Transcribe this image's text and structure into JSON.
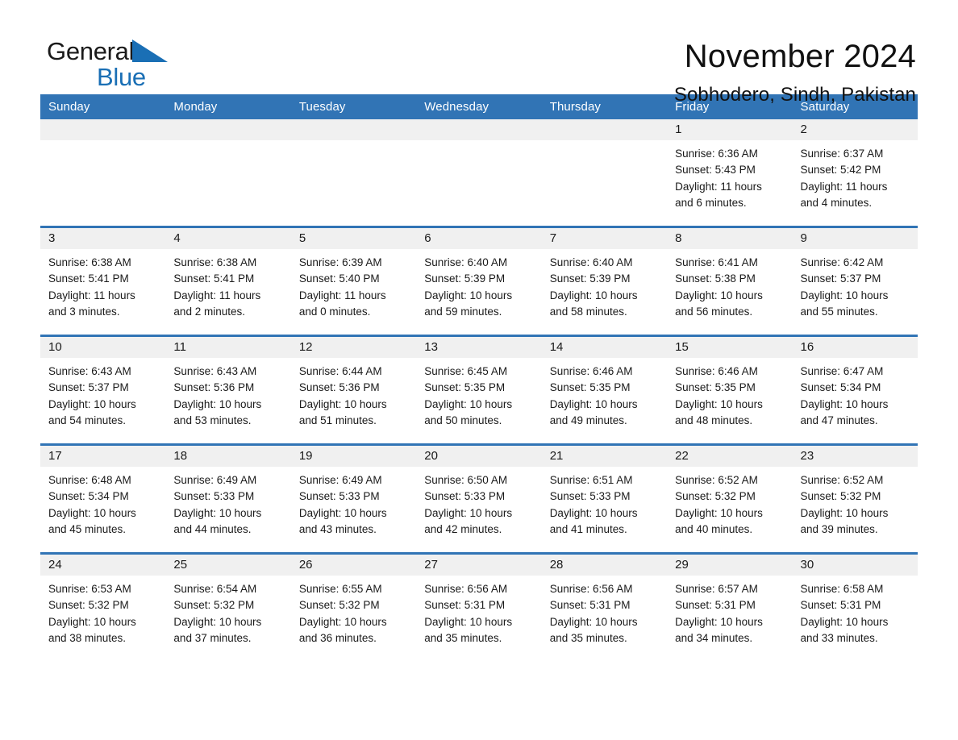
{
  "brand": {
    "name_part1": "General",
    "name_part2": "Blue",
    "logo_icon": "triangle-icon",
    "accent_color": "#1a6fb5"
  },
  "header": {
    "month_title": "November 2024",
    "location": "Sobhodero, Sindh, Pakistan"
  },
  "theme": {
    "header_blue": "#3174b5",
    "daynum_band": "#f0f0f0",
    "text": "#1a1a1a"
  },
  "weekday_headers": [
    "Sunday",
    "Monday",
    "Tuesday",
    "Wednesday",
    "Thursday",
    "Friday",
    "Saturday"
  ],
  "weeks": [
    [
      {
        "day": "",
        "empty": true,
        "sunrise": "",
        "sunset": "",
        "daylight_line1": "",
        "daylight_line2": ""
      },
      {
        "day": "",
        "empty": true,
        "sunrise": "",
        "sunset": "",
        "daylight_line1": "",
        "daylight_line2": ""
      },
      {
        "day": "",
        "empty": true,
        "sunrise": "",
        "sunset": "",
        "daylight_line1": "",
        "daylight_line2": ""
      },
      {
        "day": "",
        "empty": true,
        "sunrise": "",
        "sunset": "",
        "daylight_line1": "",
        "daylight_line2": ""
      },
      {
        "day": "",
        "empty": true,
        "sunrise": "",
        "sunset": "",
        "daylight_line1": "",
        "daylight_line2": ""
      },
      {
        "day": "1",
        "empty": false,
        "sunrise": "Sunrise: 6:36 AM",
        "sunset": "Sunset: 5:43 PM",
        "daylight_line1": "Daylight: 11 hours",
        "daylight_line2": "and 6 minutes."
      },
      {
        "day": "2",
        "empty": false,
        "sunrise": "Sunrise: 6:37 AM",
        "sunset": "Sunset: 5:42 PM",
        "daylight_line1": "Daylight: 11 hours",
        "daylight_line2": "and 4 minutes."
      }
    ],
    [
      {
        "day": "3",
        "empty": false,
        "sunrise": "Sunrise: 6:38 AM",
        "sunset": "Sunset: 5:41 PM",
        "daylight_line1": "Daylight: 11 hours",
        "daylight_line2": "and 3 minutes."
      },
      {
        "day": "4",
        "empty": false,
        "sunrise": "Sunrise: 6:38 AM",
        "sunset": "Sunset: 5:41 PM",
        "daylight_line1": "Daylight: 11 hours",
        "daylight_line2": "and 2 minutes."
      },
      {
        "day": "5",
        "empty": false,
        "sunrise": "Sunrise: 6:39 AM",
        "sunset": "Sunset: 5:40 PM",
        "daylight_line1": "Daylight: 11 hours",
        "daylight_line2": "and 0 minutes."
      },
      {
        "day": "6",
        "empty": false,
        "sunrise": "Sunrise: 6:40 AM",
        "sunset": "Sunset: 5:39 PM",
        "daylight_line1": "Daylight: 10 hours",
        "daylight_line2": "and 59 minutes."
      },
      {
        "day": "7",
        "empty": false,
        "sunrise": "Sunrise: 6:40 AM",
        "sunset": "Sunset: 5:39 PM",
        "daylight_line1": "Daylight: 10 hours",
        "daylight_line2": "and 58 minutes."
      },
      {
        "day": "8",
        "empty": false,
        "sunrise": "Sunrise: 6:41 AM",
        "sunset": "Sunset: 5:38 PM",
        "daylight_line1": "Daylight: 10 hours",
        "daylight_line2": "and 56 minutes."
      },
      {
        "day": "9",
        "empty": false,
        "sunrise": "Sunrise: 6:42 AM",
        "sunset": "Sunset: 5:37 PM",
        "daylight_line1": "Daylight: 10 hours",
        "daylight_line2": "and 55 minutes."
      }
    ],
    [
      {
        "day": "10",
        "empty": false,
        "sunrise": "Sunrise: 6:43 AM",
        "sunset": "Sunset: 5:37 PM",
        "daylight_line1": "Daylight: 10 hours",
        "daylight_line2": "and 54 minutes."
      },
      {
        "day": "11",
        "empty": false,
        "sunrise": "Sunrise: 6:43 AM",
        "sunset": "Sunset: 5:36 PM",
        "daylight_line1": "Daylight: 10 hours",
        "daylight_line2": "and 53 minutes."
      },
      {
        "day": "12",
        "empty": false,
        "sunrise": "Sunrise: 6:44 AM",
        "sunset": "Sunset: 5:36 PM",
        "daylight_line1": "Daylight: 10 hours",
        "daylight_line2": "and 51 minutes."
      },
      {
        "day": "13",
        "empty": false,
        "sunrise": "Sunrise: 6:45 AM",
        "sunset": "Sunset: 5:35 PM",
        "daylight_line1": "Daylight: 10 hours",
        "daylight_line2": "and 50 minutes."
      },
      {
        "day": "14",
        "empty": false,
        "sunrise": "Sunrise: 6:46 AM",
        "sunset": "Sunset: 5:35 PM",
        "daylight_line1": "Daylight: 10 hours",
        "daylight_line2": "and 49 minutes."
      },
      {
        "day": "15",
        "empty": false,
        "sunrise": "Sunrise: 6:46 AM",
        "sunset": "Sunset: 5:35 PM",
        "daylight_line1": "Daylight: 10 hours",
        "daylight_line2": "and 48 minutes."
      },
      {
        "day": "16",
        "empty": false,
        "sunrise": "Sunrise: 6:47 AM",
        "sunset": "Sunset: 5:34 PM",
        "daylight_line1": "Daylight: 10 hours",
        "daylight_line2": "and 47 minutes."
      }
    ],
    [
      {
        "day": "17",
        "empty": false,
        "sunrise": "Sunrise: 6:48 AM",
        "sunset": "Sunset: 5:34 PM",
        "daylight_line1": "Daylight: 10 hours",
        "daylight_line2": "and 45 minutes."
      },
      {
        "day": "18",
        "empty": false,
        "sunrise": "Sunrise: 6:49 AM",
        "sunset": "Sunset: 5:33 PM",
        "daylight_line1": "Daylight: 10 hours",
        "daylight_line2": "and 44 minutes."
      },
      {
        "day": "19",
        "empty": false,
        "sunrise": "Sunrise: 6:49 AM",
        "sunset": "Sunset: 5:33 PM",
        "daylight_line1": "Daylight: 10 hours",
        "daylight_line2": "and 43 minutes."
      },
      {
        "day": "20",
        "empty": false,
        "sunrise": "Sunrise: 6:50 AM",
        "sunset": "Sunset: 5:33 PM",
        "daylight_line1": "Daylight: 10 hours",
        "daylight_line2": "and 42 minutes."
      },
      {
        "day": "21",
        "empty": false,
        "sunrise": "Sunrise: 6:51 AM",
        "sunset": "Sunset: 5:33 PM",
        "daylight_line1": "Daylight: 10 hours",
        "daylight_line2": "and 41 minutes."
      },
      {
        "day": "22",
        "empty": false,
        "sunrise": "Sunrise: 6:52 AM",
        "sunset": "Sunset: 5:32 PM",
        "daylight_line1": "Daylight: 10 hours",
        "daylight_line2": "and 40 minutes."
      },
      {
        "day": "23",
        "empty": false,
        "sunrise": "Sunrise: 6:52 AM",
        "sunset": "Sunset: 5:32 PM",
        "daylight_line1": "Daylight: 10 hours",
        "daylight_line2": "and 39 minutes."
      }
    ],
    [
      {
        "day": "24",
        "empty": false,
        "sunrise": "Sunrise: 6:53 AM",
        "sunset": "Sunset: 5:32 PM",
        "daylight_line1": "Daylight: 10 hours",
        "daylight_line2": "and 38 minutes."
      },
      {
        "day": "25",
        "empty": false,
        "sunrise": "Sunrise: 6:54 AM",
        "sunset": "Sunset: 5:32 PM",
        "daylight_line1": "Daylight: 10 hours",
        "daylight_line2": "and 37 minutes."
      },
      {
        "day": "26",
        "empty": false,
        "sunrise": "Sunrise: 6:55 AM",
        "sunset": "Sunset: 5:32 PM",
        "daylight_line1": "Daylight: 10 hours",
        "daylight_line2": "and 36 minutes."
      },
      {
        "day": "27",
        "empty": false,
        "sunrise": "Sunrise: 6:56 AM",
        "sunset": "Sunset: 5:31 PM",
        "daylight_line1": "Daylight: 10 hours",
        "daylight_line2": "and 35 minutes."
      },
      {
        "day": "28",
        "empty": false,
        "sunrise": "Sunrise: 6:56 AM",
        "sunset": "Sunset: 5:31 PM",
        "daylight_line1": "Daylight: 10 hours",
        "daylight_line2": "and 35 minutes."
      },
      {
        "day": "29",
        "empty": false,
        "sunrise": "Sunrise: 6:57 AM",
        "sunset": "Sunset: 5:31 PM",
        "daylight_line1": "Daylight: 10 hours",
        "daylight_line2": "and 34 minutes."
      },
      {
        "day": "30",
        "empty": false,
        "sunrise": "Sunrise: 6:58 AM",
        "sunset": "Sunset: 5:31 PM",
        "daylight_line1": "Daylight: 10 hours",
        "daylight_line2": "and 33 minutes."
      }
    ]
  ]
}
